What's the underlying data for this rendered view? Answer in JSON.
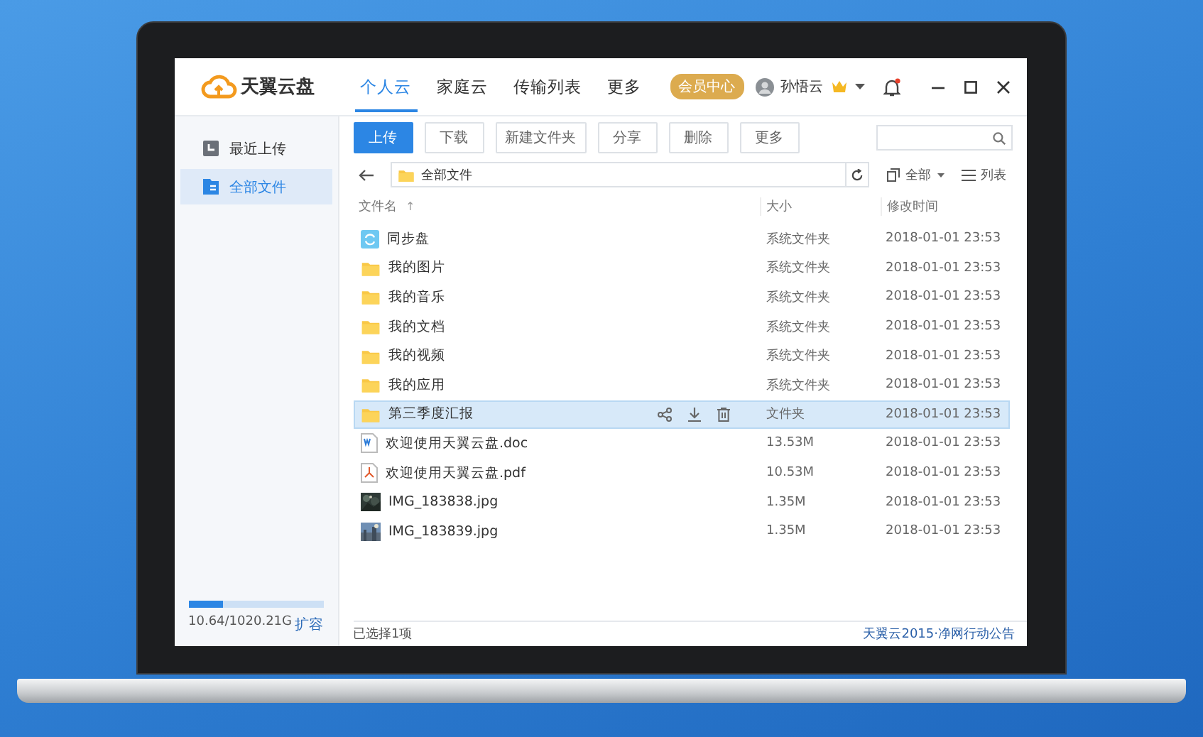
{
  "app": {
    "name": "天翼云盘"
  },
  "tabs": [
    {
      "label": "个人云",
      "selected": true
    },
    {
      "label": "家庭云",
      "selected": false
    },
    {
      "label": "传输列表",
      "selected": false
    },
    {
      "label": "更多",
      "selected": false
    }
  ],
  "header": {
    "vip_badge": "会员中心",
    "user": {
      "name": "孙悟云",
      "vip": true
    },
    "notification": true
  },
  "sidebar": {
    "items": [
      {
        "label": "最近上传",
        "kind": "recent",
        "selected": false
      },
      {
        "label": "全部文件",
        "kind": "files",
        "selected": true
      }
    ],
    "storage": {
      "level": 0.26,
      "usage": "10.64/1020.21G",
      "expand": "扩容"
    }
  },
  "toolbar": {
    "buttons": [
      {
        "label": "上传",
        "primary": true
      },
      {
        "label": "下载",
        "primary": false
      },
      {
        "label": "新建文件夹",
        "primary": false
      },
      {
        "label": "分享",
        "primary": false
      },
      {
        "label": "删除",
        "primary": false
      },
      {
        "label": "更多",
        "primary": false
      }
    ]
  },
  "path": {
    "current": "全部文件",
    "filter": "全部",
    "view": "列表"
  },
  "table": {
    "columns": [
      {
        "label": "文件名",
        "sort": "↑"
      },
      {
        "label": "大小"
      },
      {
        "label": "修改时间"
      }
    ],
    "rows": [
      {
        "kind": "sync",
        "name": "同步盘",
        "size": "系统文件夹",
        "modified": "2018-01-01 23:53",
        "selected": false
      },
      {
        "kind": "folder",
        "name": "我的图片",
        "size": "系统文件夹",
        "modified": "2018-01-01 23:53",
        "selected": false
      },
      {
        "kind": "folder",
        "name": "我的音乐",
        "size": "系统文件夹",
        "modified": "2018-01-01 23:53",
        "selected": false
      },
      {
        "kind": "folder",
        "name": "我的文档",
        "size": "系统文件夹",
        "modified": "2018-01-01 23:53",
        "selected": false
      },
      {
        "kind": "folder",
        "name": "我的视频",
        "size": "系统文件夹",
        "modified": "2018-01-01 23:53",
        "selected": false
      },
      {
        "kind": "folder",
        "name": "我的应用",
        "size": "系统文件夹",
        "modified": "2018-01-01 23:53",
        "selected": false
      },
      {
        "kind": "folder",
        "name": "第三季度汇报",
        "size": "文件夹",
        "modified": "2018-01-01 23:53",
        "selected": true
      },
      {
        "kind": "doc",
        "name": "欢迎使用天翼云盘.doc",
        "size": "13.53M",
        "modified": "2018-01-01 23:53",
        "selected": false
      },
      {
        "kind": "pdf",
        "name": "欢迎使用天翼云盘.pdf",
        "size": "10.53M",
        "modified": "2018-01-01 23:53",
        "selected": false
      },
      {
        "name": "IMG_183838.jpg",
        "size": "1.35M",
        "modified": "2018-01-01 23:53",
        "selected": false
      },
      {
        "name": "IMG_183839.jpg",
        "size": "1.35M",
        "modified": "2018-01-01 23:53",
        "selected": false
      }
    ]
  },
  "status_bar": {
    "selection": "已选择1项",
    "notice": "天翼云2015·净网行动公告"
  }
}
